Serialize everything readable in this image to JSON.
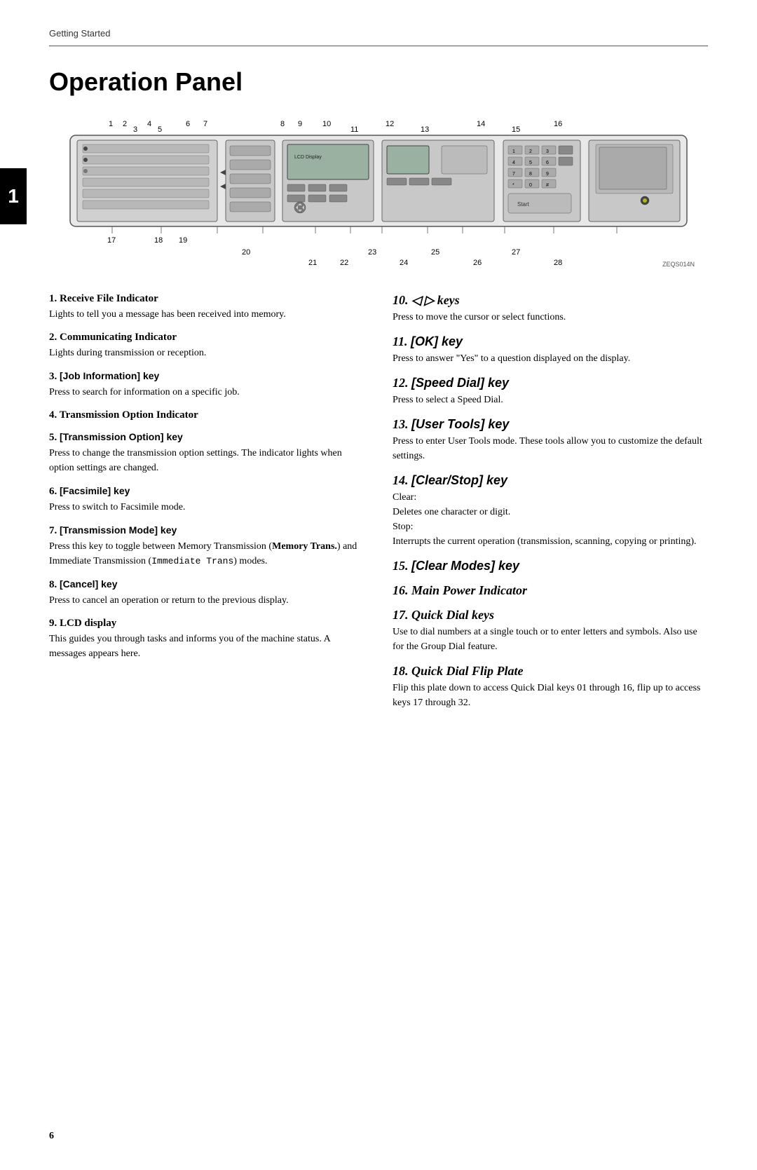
{
  "header": {
    "breadcrumb": "Getting Started",
    "title": "Operation Panel"
  },
  "chapter_number": "1",
  "diagram": {
    "label": "ZEQS014N",
    "number_labels_top": [
      "1",
      "2",
      "4",
      "3",
      "5",
      "6",
      "7",
      "8",
      "9",
      "10",
      "11",
      "12",
      "13",
      "14",
      "15",
      "16"
    ],
    "number_labels_bottom": [
      "17",
      "18",
      "19",
      "20",
      "21",
      "22",
      "23",
      "24",
      "25",
      "26",
      "27",
      "28"
    ]
  },
  "left_column": [
    {
      "number": "1.",
      "title": "Receive File Indicator",
      "style": "bold",
      "body": "Lights to tell you a message has been received into memory."
    },
    {
      "number": "2.",
      "title": "Communicating Indicator",
      "style": "bold",
      "body": "Lights during transmission or reception."
    },
    {
      "number": "3.",
      "title": "[Job Information] key",
      "style": "bracket-bold",
      "body": "Press to search for information on a specific job."
    },
    {
      "number": "4.",
      "title": "Transmission Option Indicator",
      "style": "bold",
      "body": ""
    },
    {
      "number": "5.",
      "title": "[Transmission Option] key",
      "style": "bracket-bold",
      "body": "Press to change the transmission option settings. The indicator lights when option settings are changed."
    },
    {
      "number": "6.",
      "title": "[Facsimile] key",
      "style": "bracket-bold",
      "body": "Press to switch to Facsimile mode."
    },
    {
      "number": "7.",
      "title": "[Transmission Mode] key",
      "style": "bracket-bold",
      "body": "Press this key to toggle between Memory Transmission (Memory Trans.) and Immediate Transmission (Immediate Trans) modes."
    },
    {
      "number": "8.",
      "title": "[Cancel] key",
      "style": "bracket-bold",
      "body": "Press to cancel an operation or return to the previous display."
    },
    {
      "number": "9.",
      "title": "LCD display",
      "style": "bold",
      "body": "This guides you through tasks and informs you of the machine status. A messages appears here."
    }
  ],
  "right_column": [
    {
      "number": "10.",
      "title": "◁ ▷ keys",
      "style": "italic-large",
      "body": "Press to move the cursor or select functions."
    },
    {
      "number": "11.",
      "title": "[OK] key",
      "style": "italic-large-bracket",
      "body": "Press to answer \"Yes\" to a question displayed on the display."
    },
    {
      "number": "12.",
      "title": "[Speed Dial] key",
      "style": "italic-large-bracket",
      "body": "Press to select a Speed Dial."
    },
    {
      "number": "13.",
      "title": "[User Tools] key",
      "style": "italic-large-bracket",
      "body": "Press to enter User Tools mode. These tools allow you to customize the default settings."
    },
    {
      "number": "14.",
      "title": "[Clear/Stop] key",
      "style": "italic-large-bracket",
      "body": "Clear:\nDeletes one character or digit.\nStop:\nInterrupts the current operation (transmission, scanning, copying or printing)."
    },
    {
      "number": "15.",
      "title": "[Clear Modes] key",
      "style": "italic-large-bracket",
      "body": ""
    },
    {
      "number": "16.",
      "title": "Main Power Indicator",
      "style": "italic-large-bold",
      "body": ""
    },
    {
      "number": "17.",
      "title": "Quick Dial keys",
      "style": "italic-large-bold",
      "body": "Use to dial numbers at a single touch or to enter letters and symbols. Also use for the Group Dial feature."
    },
    {
      "number": "18.",
      "title": "Quick Dial Flip Plate",
      "style": "italic-large-bold",
      "body": "Flip this plate down to access Quick Dial keys 01 through 16, flip up to access keys 17 through 32."
    }
  ],
  "page_number": "6",
  "item7_memory_trans": "Memory Trans.",
  "item7_immediate_trans": "Immediate",
  "item7_immediate_trans2": "Trans"
}
